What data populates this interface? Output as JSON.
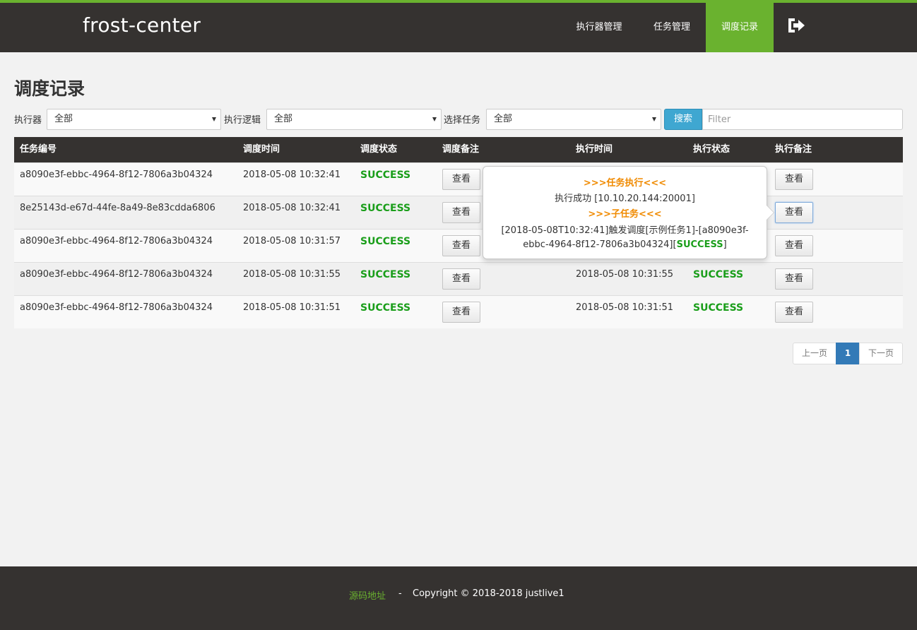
{
  "app": {
    "brand": "frost-center"
  },
  "colors": {
    "accent": "#6ab22f",
    "nav_bg": "#353230",
    "success": "#1a9e1a",
    "popover_head": "#f08a00",
    "primary": "#337ab7",
    "info": "#3fa7d1"
  },
  "nav": {
    "items": [
      {
        "label": "执行器管理"
      },
      {
        "label": "任务管理"
      },
      {
        "label": "调度记录",
        "active": true
      }
    ],
    "logout_icon": "sign-out-icon"
  },
  "page": {
    "title": "调度记录"
  },
  "filters": {
    "executor_label": "执行器",
    "executor_value": "全部",
    "logic_label": "执行逻辑",
    "logic_value": "全部",
    "task_label": "选择任务",
    "task_value": "全部",
    "search_label": "搜索",
    "filter_placeholder": "Filter"
  },
  "table": {
    "headers": [
      "任务编号",
      "调度时间",
      "调度状态",
      "调度备注",
      "执行时间",
      "执行状态",
      "执行备注"
    ],
    "view_label": "查看",
    "rows": [
      {
        "id": "a8090e3f-ebbc-4964-8f12-7806a3b04324",
        "dispatch_time": "2018-05-08 10:32:41",
        "dispatch_status": "SUCCESS",
        "exec_time": "",
        "exec_status": ""
      },
      {
        "id": "8e25143d-e67d-44fe-8a49-8e83cdda6806",
        "dispatch_time": "2018-05-08 10:32:41",
        "dispatch_status": "SUCCESS",
        "exec_time": "",
        "exec_status": ""
      },
      {
        "id": "a8090e3f-ebbc-4964-8f12-7806a3b04324",
        "dispatch_time": "2018-05-08 10:31:57",
        "dispatch_status": "SUCCESS",
        "exec_time": "",
        "exec_status": ""
      },
      {
        "id": "a8090e3f-ebbc-4964-8f12-7806a3b04324",
        "dispatch_time": "2018-05-08 10:31:55",
        "dispatch_status": "SUCCESS",
        "exec_time": "2018-05-08 10:31:55",
        "exec_status": "SUCCESS"
      },
      {
        "id": "a8090e3f-ebbc-4964-8f12-7806a3b04324",
        "dispatch_time": "2018-05-08 10:31:51",
        "dispatch_status": "SUCCESS",
        "exec_time": "2018-05-08 10:31:51",
        "exec_status": "SUCCESS"
      }
    ]
  },
  "popover": {
    "head1": ">>>任务执行<<<",
    "line1": "执行成功 [10.10.20.144:20001]",
    "head2": ">>>子任务<<<",
    "line2a": "[2018-05-08T10:32:41]触发调度[示例任务1]-[a8090e3f-",
    "line2b": "ebbc-4964-8f12-7806a3b04324][",
    "line2_status": "SUCCESS",
    "line2c": "]"
  },
  "pagination": {
    "prev": "上一页",
    "current": "1",
    "next": "下一页"
  },
  "footer": {
    "link": "源码地址",
    "separator": "-",
    "copyright": "Copyright © 2018-2018 justlive1"
  }
}
